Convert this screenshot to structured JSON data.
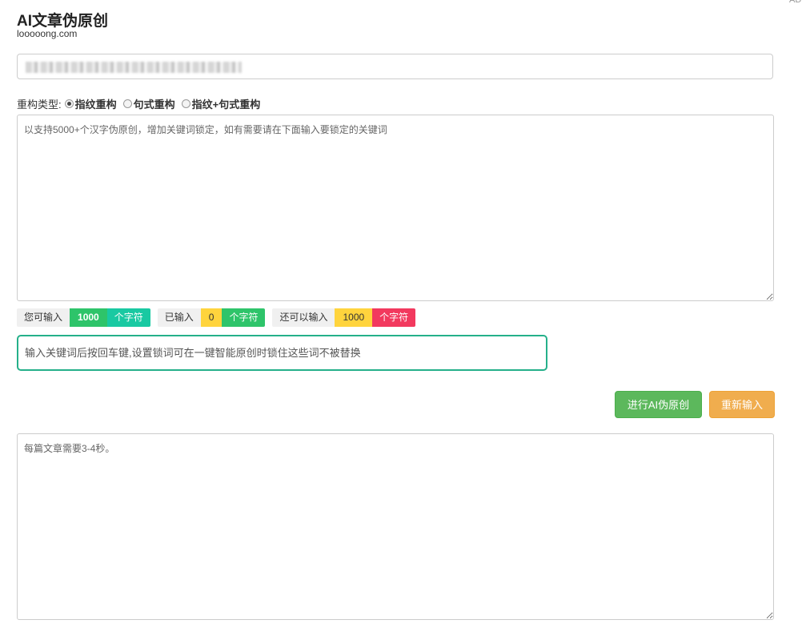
{
  "corner_label": "AD",
  "header": {
    "title": "AI文章伪原创",
    "subtitle": "looooong.com"
  },
  "url_field": {
    "value_state": "blurred"
  },
  "mode": {
    "label": "重构类型:",
    "options": [
      {
        "label": "指纹重构",
        "checked": true
      },
      {
        "label": "句式重构",
        "checked": false
      },
      {
        "label": "指纹+句式重构",
        "checked": false
      }
    ]
  },
  "input_area": {
    "placeholder": "以支持5000+个汉字伪原创，增加关键词锁定，如有需要请在下面输入要锁定的关键词"
  },
  "counters": [
    {
      "label": "您可输入",
      "value": "1000",
      "unit": "个字符"
    },
    {
      "label": "已输入",
      "value": "0",
      "unit": "个字符"
    },
    {
      "label": "还可以输入",
      "value": "1000",
      "unit": "个字符"
    }
  ],
  "keyword": {
    "placeholder": "输入关键词后按回车键,设置锁词可在一键智能原创时锁住这些词不被替换"
  },
  "buttons": {
    "go": "进行AI伪原创",
    "reset": "重新输入"
  },
  "output_area": {
    "placeholder": "每篇文章需要3-4秒。"
  },
  "colors": {
    "green": "#5cb85c",
    "orange": "#f0ad4e",
    "teal_border": "#25b08a",
    "badge_red": "#f2395e",
    "badge_yellow": "#ffd43d"
  }
}
